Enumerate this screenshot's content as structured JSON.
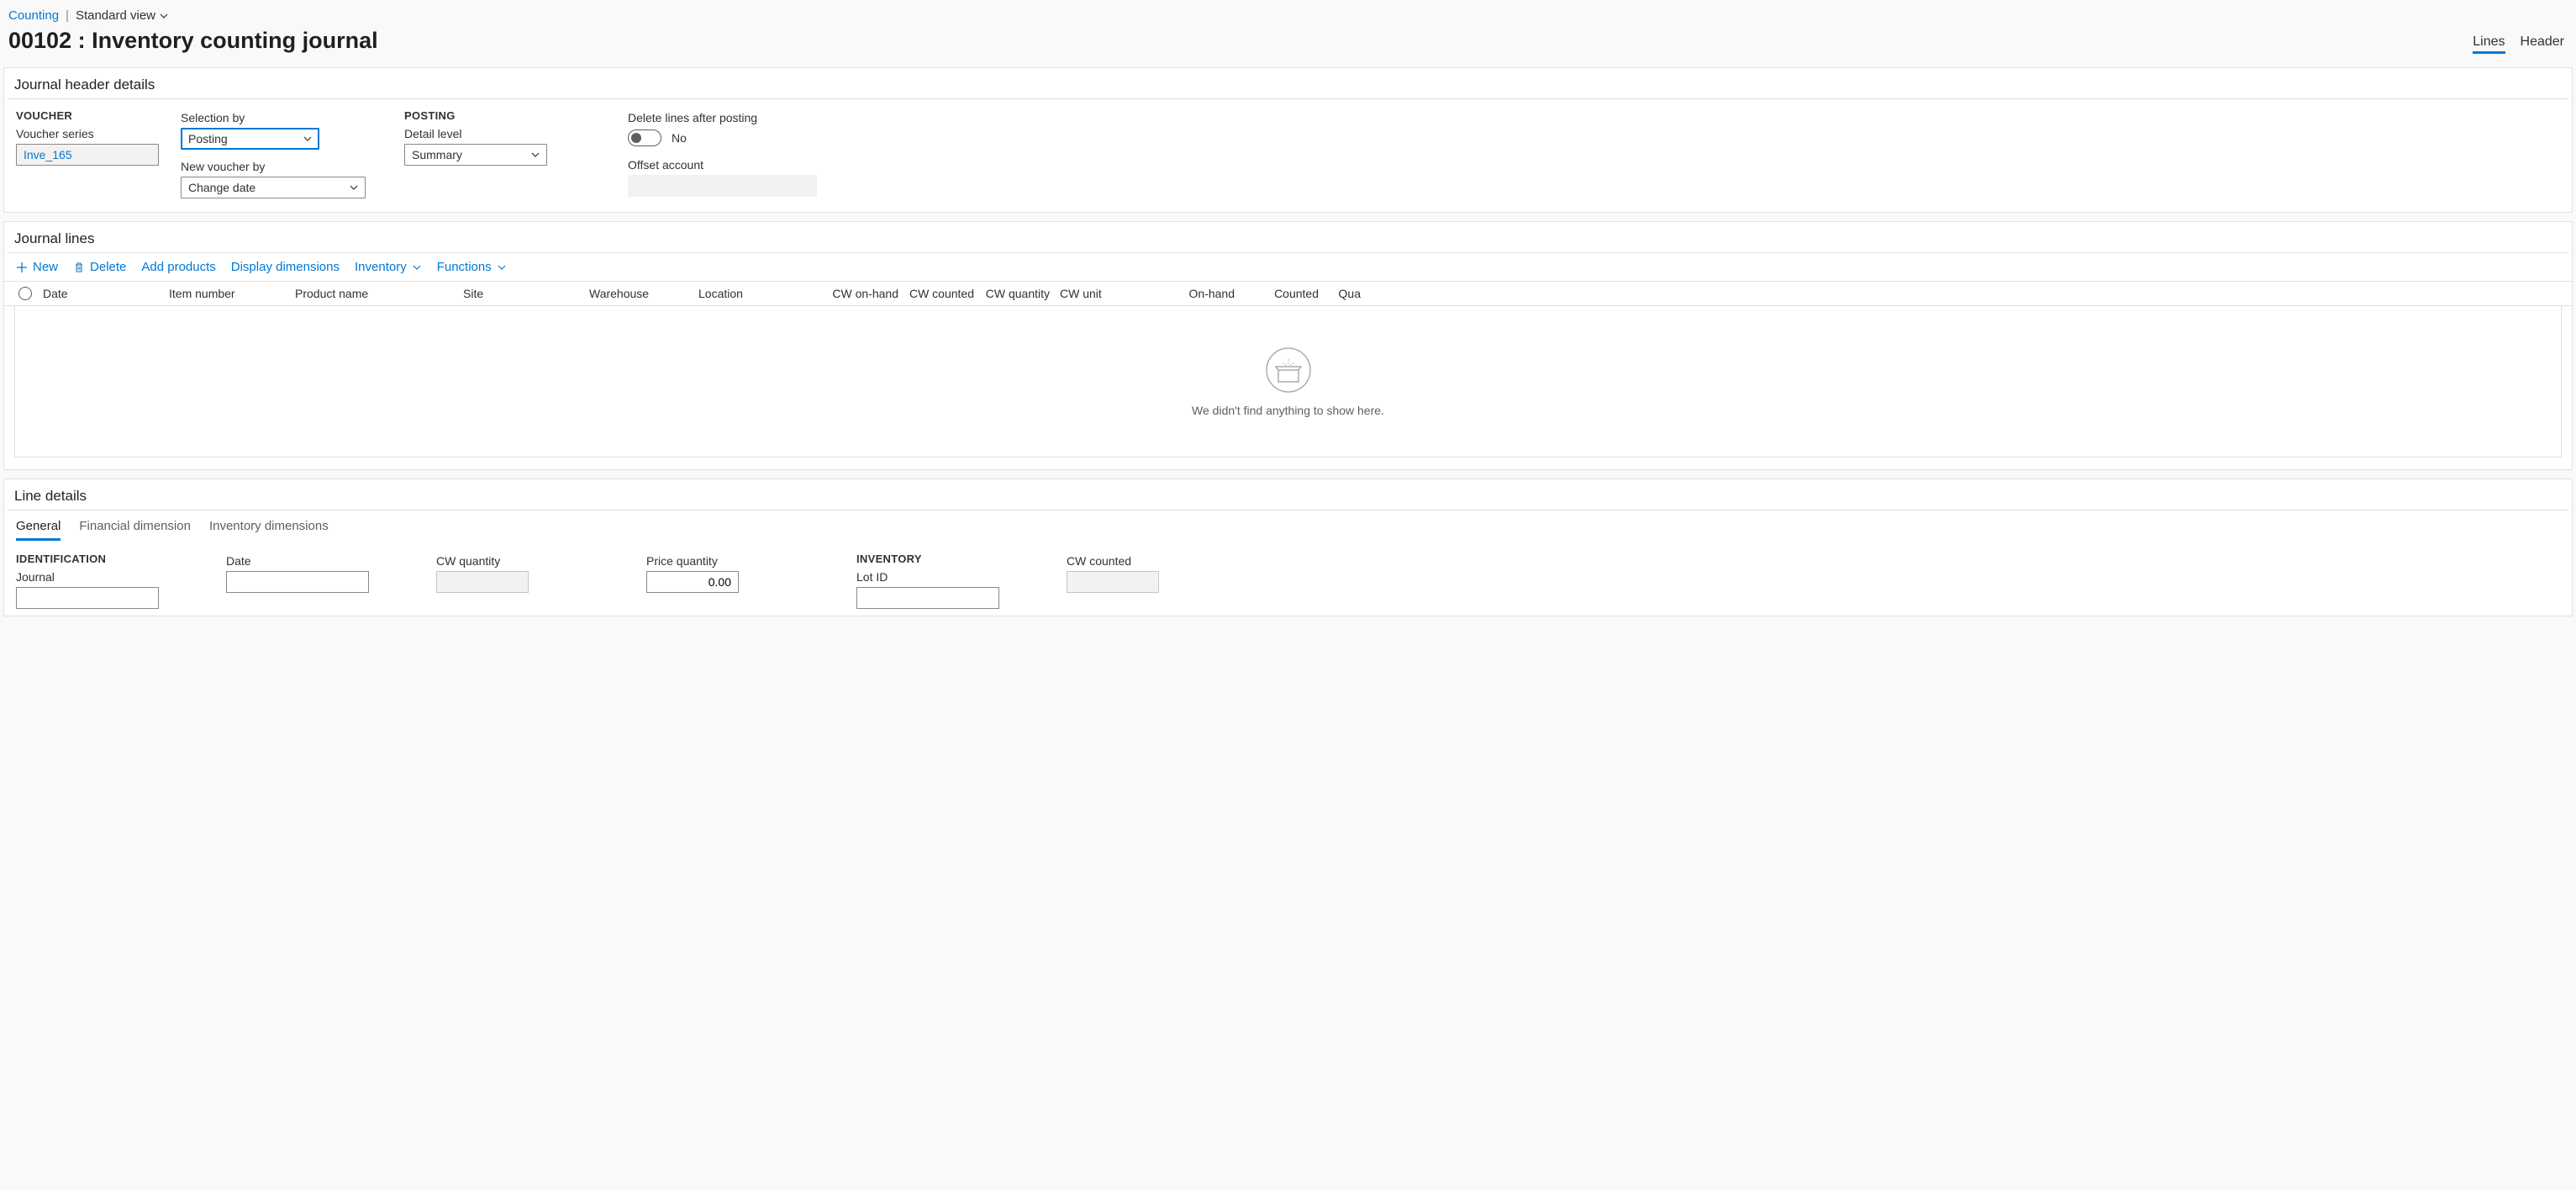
{
  "breadcrumb": {
    "link": "Counting",
    "view": "Standard view"
  },
  "page_title": "00102 : Inventory counting journal",
  "top_tabs": {
    "lines": "Lines",
    "header": "Header"
  },
  "journal_header": {
    "title": "Journal header details",
    "voucher_group": "VOUCHER",
    "voucher_series_label": "Voucher series",
    "voucher_series_value": "Inve_165",
    "selection_by_label": "Selection by",
    "selection_by_value": "Posting",
    "new_voucher_by_label": "New voucher by",
    "new_voucher_by_value": "Change date",
    "posting_group": "POSTING",
    "detail_level_label": "Detail level",
    "detail_level_value": "Summary",
    "delete_lines_label": "Delete lines after posting",
    "delete_lines_value": "No",
    "offset_account_label": "Offset account",
    "offset_account_value": ""
  },
  "journal_lines": {
    "title": "Journal lines",
    "toolbar": {
      "new": "New",
      "delete": "Delete",
      "add_products": "Add products",
      "display_dimensions": "Display dimensions",
      "inventory": "Inventory",
      "functions": "Functions"
    },
    "columns": {
      "date": "Date",
      "item_number": "Item number",
      "product_name": "Product name",
      "site": "Site",
      "warehouse": "Warehouse",
      "location": "Location",
      "cw_onhand": "CW on-hand",
      "cw_counted": "CW counted",
      "cw_quantity": "CW quantity",
      "cw_unit": "CW unit",
      "on_hand": "On-hand",
      "counted": "Counted",
      "quantity": "Qua"
    },
    "empty_message": "We didn't find anything to show here."
  },
  "line_details": {
    "title": "Line details",
    "tabs": {
      "general": "General",
      "financial_dimension": "Financial dimension",
      "inventory_dimensions": "Inventory dimensions"
    },
    "identification_group": "IDENTIFICATION",
    "journal_label": "Journal",
    "date_label": "Date",
    "date_value": "",
    "cw_quantity_label": "CW quantity",
    "cw_quantity_value": "",
    "price_quantity_label": "Price quantity",
    "price_quantity_value": "0.00",
    "inventory_group": "INVENTORY",
    "lot_id_label": "Lot ID",
    "cw_counted_label": "CW counted",
    "cw_counted_value": ""
  }
}
